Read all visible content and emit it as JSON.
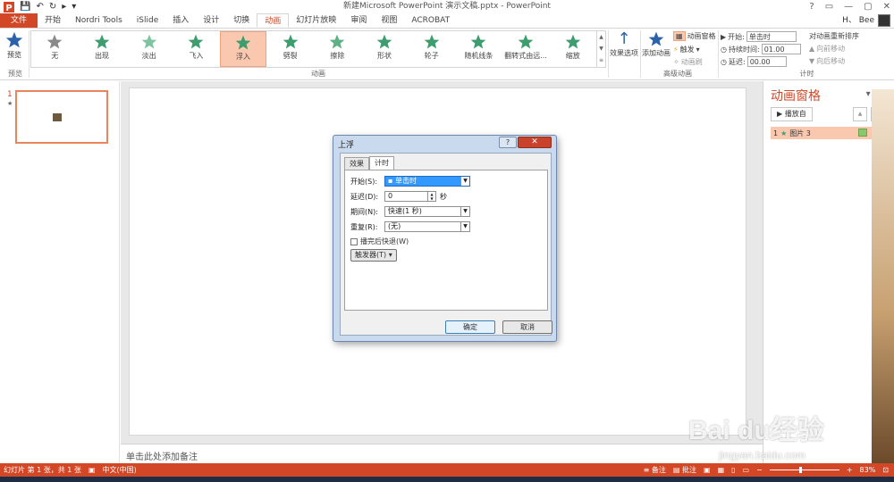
{
  "window": {
    "title": "新建Microsoft PowerPoint 演示文稿.pptx - PowerPoint",
    "controls": [
      "?",
      "▭",
      "—",
      "▢",
      "✕"
    ]
  },
  "tabs": [
    {
      "label": "文件"
    },
    {
      "label": "开始"
    },
    {
      "label": "Nordri Tools"
    },
    {
      "label": "iSlide"
    },
    {
      "label": "插入"
    },
    {
      "label": "设计"
    },
    {
      "label": "切换"
    },
    {
      "label": "动画"
    },
    {
      "label": "幻灯片放映"
    },
    {
      "label": "审阅"
    },
    {
      "label": "视图"
    },
    {
      "label": "ACROBAT"
    }
  ],
  "user": {
    "name": "H、 Bee"
  },
  "ribbon": {
    "preview_label": "预览",
    "preview_group": "预览",
    "animation_group": "动画",
    "advanced_group": "高级动画",
    "timing_group": "计时",
    "gallery": [
      {
        "label": "无"
      },
      {
        "label": "出现"
      },
      {
        "label": "淡出"
      },
      {
        "label": "飞入"
      },
      {
        "label": "浮入"
      },
      {
        "label": "劈裂"
      },
      {
        "label": "擦除"
      },
      {
        "label": "形状"
      },
      {
        "label": "轮子"
      },
      {
        "label": "随机线条"
      },
      {
        "label": "翻转式由远..."
      },
      {
        "label": "缩放"
      }
    ],
    "effect_options": "效果选项",
    "add_animation": "添加动画",
    "anim_pane_btn": "动画窗格",
    "trigger": "触发",
    "anim_painter": "动画刷",
    "start_label": "开始:",
    "start_value": "单击时",
    "duration_label": "持续时间:",
    "duration_value": "01.00",
    "delay_label": "延迟:",
    "delay_value": "00.00",
    "reorder_title": "对动画重新排序",
    "move_earlier": "向前移动",
    "move_later": "向后移动"
  },
  "slides": [
    {
      "number": "1"
    }
  ],
  "notes_placeholder": "单击此处添加备注",
  "anim_pane": {
    "title": "动画窗格",
    "play_from": "播放自",
    "items": [
      {
        "index": "1",
        "label": "图片 3"
      }
    ]
  },
  "dialog": {
    "title": "上浮",
    "tabs": [
      "效果",
      "计时"
    ],
    "start_label": "开始(S):",
    "start_value": "单击时",
    "delay_label": "延迟(D):",
    "delay_value": "0",
    "delay_unit": "秒",
    "period_label": "期间(N):",
    "period_value": "快速(1 秒)",
    "repeat_label": "重复(R):",
    "repeat_value": "(无)",
    "rewind_label": "播完后快退(W)",
    "trigger_btn": "触发器(T)",
    "ok": "确定",
    "cancel": "取消"
  },
  "status": {
    "slide_info": "幻灯片 第 1 张，共 1 张",
    "language": "中文(中国)",
    "notes": "备注",
    "comments": "批注",
    "zoom": "83%"
  },
  "watermark": {
    "logo": "Bai du经验",
    "url": "jingyan.baidu.com"
  },
  "colors": {
    "accent": "#d24726",
    "selected": "#f9c8ae",
    "star": "#3e9d6e"
  }
}
